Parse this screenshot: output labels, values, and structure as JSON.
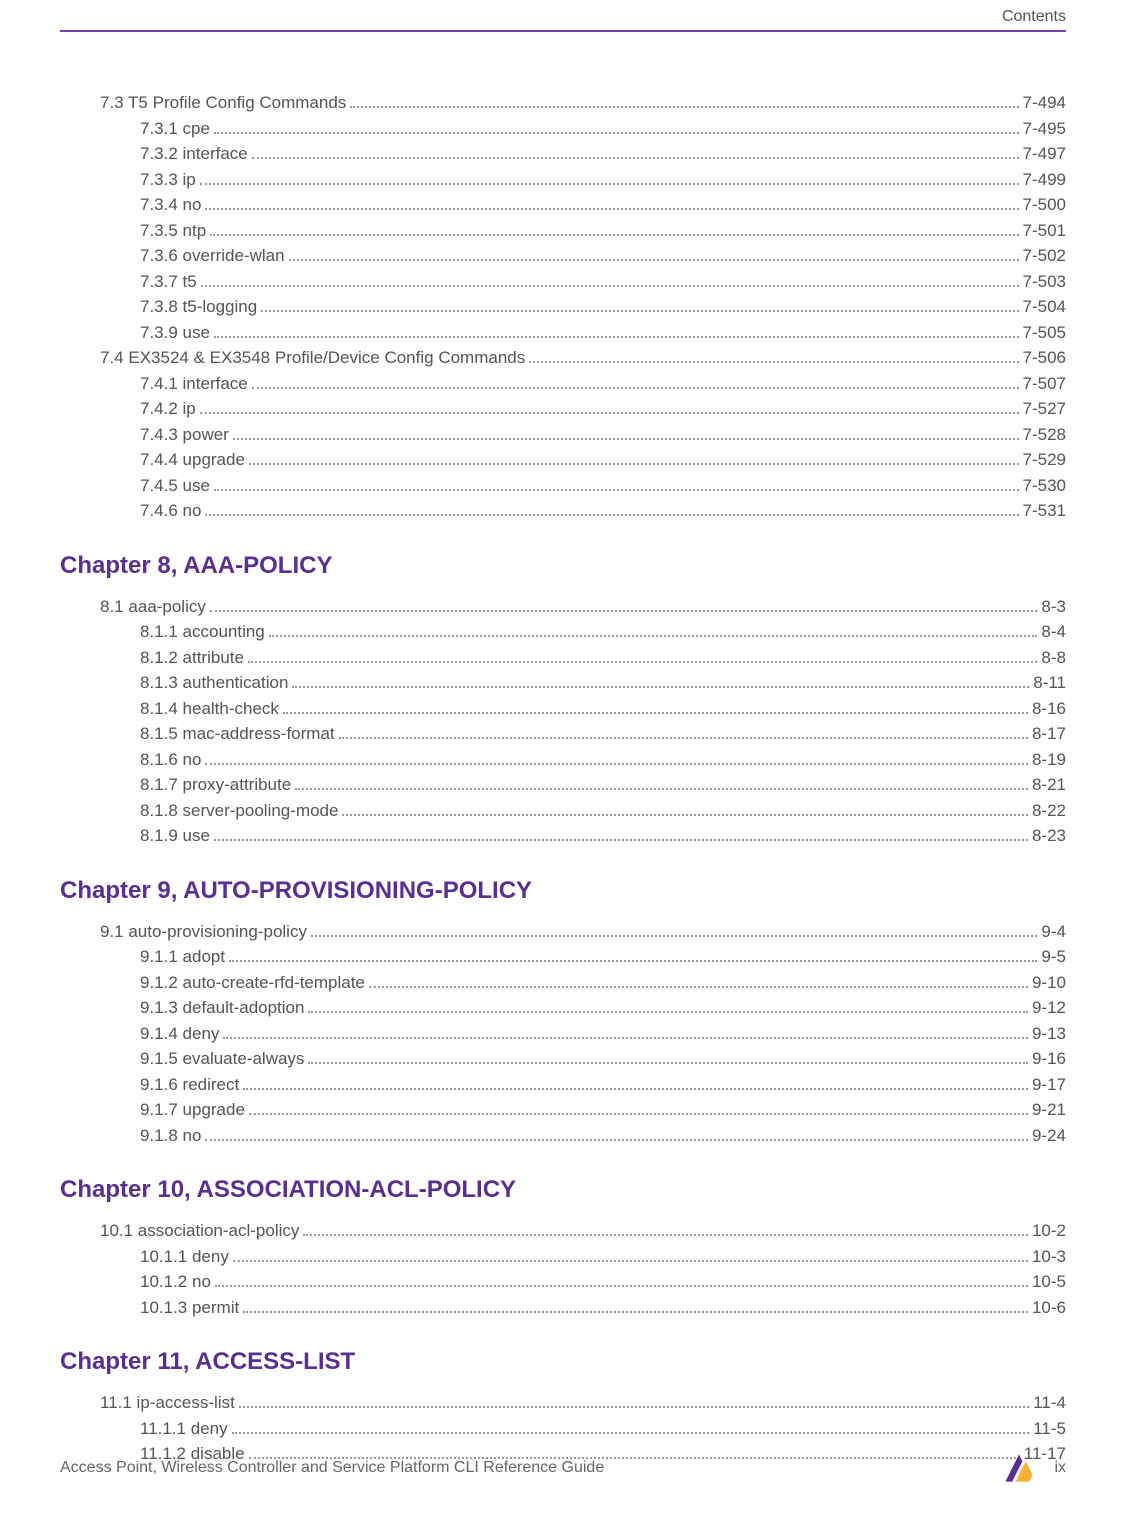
{
  "header": {
    "section_label": "Contents"
  },
  "sections": [
    {
      "type": "toc_block",
      "entries": [
        {
          "level": 1,
          "label": "7.3  T5 Profile Config Commands",
          "page": "7-494"
        },
        {
          "level": 2,
          "label": "7.3.1  cpe",
          "page": "7-495"
        },
        {
          "level": 2,
          "label": "7.3.2  interface",
          "page": "7-497"
        },
        {
          "level": 2,
          "label": "7.3.3  ip",
          "page": "7-499"
        },
        {
          "level": 2,
          "label": "7.3.4  no",
          "page": "7-500"
        },
        {
          "level": 2,
          "label": "7.3.5  ntp",
          "page": "7-501"
        },
        {
          "level": 2,
          "label": "7.3.6  override-wlan",
          "page": "7-502"
        },
        {
          "level": 2,
          "label": "7.3.7  t5",
          "page": "7-503"
        },
        {
          "level": 2,
          "label": "7.3.8  t5-logging",
          "page": "7-504"
        },
        {
          "level": 2,
          "label": "7.3.9  use",
          "page": "7-505"
        },
        {
          "level": 1,
          "label": "7.4  EX3524 & EX3548 Profile/Device Config Commands",
          "page": "7-506"
        },
        {
          "level": 2,
          "label": "7.4.1  interface",
          "page": "7-507"
        },
        {
          "level": 2,
          "label": "7.4.2  ip",
          "page": "7-527"
        },
        {
          "level": 2,
          "label": "7.4.3  power",
          "page": "7-528"
        },
        {
          "level": 2,
          "label": "7.4.4  upgrade",
          "page": "7-529"
        },
        {
          "level": 2,
          "label": "7.4.5  use",
          "page": "7-530"
        },
        {
          "level": 2,
          "label": "7.4.6  no",
          "page": "7-531"
        }
      ]
    },
    {
      "type": "chapter_title",
      "text": "Chapter 8, AAA-POLICY"
    },
    {
      "type": "toc_block",
      "entries": [
        {
          "level": 1,
          "label": "8.1  aaa-policy",
          "page": "8-3"
        },
        {
          "level": 2,
          "label": "8.1.1  accounting",
          "page": "8-4"
        },
        {
          "level": 2,
          "label": "8.1.2  attribute",
          "page": "8-8"
        },
        {
          "level": 2,
          "label": "8.1.3  authentication",
          "page": "8-11"
        },
        {
          "level": 2,
          "label": "8.1.4  health-check",
          "page": "8-16"
        },
        {
          "level": 2,
          "label": "8.1.5  mac-address-format",
          "page": "8-17"
        },
        {
          "level": 2,
          "label": "8.1.6  no",
          "page": "8-19"
        },
        {
          "level": 2,
          "label": "8.1.7  proxy-attribute",
          "page": "8-21"
        },
        {
          "level": 2,
          "label": "8.1.8  server-pooling-mode",
          "page": "8-22"
        },
        {
          "level": 2,
          "label": "8.1.9  use",
          "page": "8-23"
        }
      ]
    },
    {
      "type": "chapter_title",
      "text": "Chapter 9, AUTO-PROVISIONING-POLICY"
    },
    {
      "type": "toc_block",
      "entries": [
        {
          "level": 1,
          "label": "9.1  auto-provisioning-policy",
          "page": "9-4"
        },
        {
          "level": 2,
          "label": "9.1.1  adopt",
          "page": "9-5"
        },
        {
          "level": 2,
          "label": "9.1.2  auto-create-rfd-template",
          "page": "9-10"
        },
        {
          "level": 2,
          "label": "9.1.3  default-adoption",
          "page": "9-12"
        },
        {
          "level": 2,
          "label": "9.1.4  deny",
          "page": "9-13"
        },
        {
          "level": 2,
          "label": "9.1.5  evaluate-always",
          "page": "9-16"
        },
        {
          "level": 2,
          "label": "9.1.6  redirect",
          "page": "9-17"
        },
        {
          "level": 2,
          "label": "9.1.7  upgrade",
          "page": "9-21"
        },
        {
          "level": 2,
          "label": "9.1.8  no",
          "page": "9-24"
        }
      ]
    },
    {
      "type": "chapter_title",
      "text": "Chapter 10, ASSOCIATION-ACL-POLICY"
    },
    {
      "type": "toc_block",
      "entries": [
        {
          "level": 1,
          "label": "10.1  association-acl-policy",
          "page": "10-2"
        },
        {
          "level": 2,
          "label": "10.1.1  deny",
          "page": "10-3"
        },
        {
          "level": 2,
          "label": "10.1.2  no",
          "page": "10-5"
        },
        {
          "level": 2,
          "label": "10.1.3  permit",
          "page": "10-6"
        }
      ]
    },
    {
      "type": "chapter_title",
      "text": "Chapter 11, ACCESS-LIST"
    },
    {
      "type": "toc_block",
      "entries": [
        {
          "level": 1,
          "label": "11.1  ip-access-list",
          "page": "11-4"
        },
        {
          "level": 2,
          "label": "11.1.1  deny",
          "page": "11-5"
        },
        {
          "level": 2,
          "label": "11.1.2  disable",
          "page": "11-17"
        }
      ]
    }
  ],
  "footer": {
    "title": "Access Point, Wireless Controller and Service Platform CLI Reference Guide",
    "page_number": "ix"
  },
  "colors": {
    "accent_purple": "#5b2e91",
    "rule_purple": "#7b3fb5",
    "body_text": "#555555"
  }
}
